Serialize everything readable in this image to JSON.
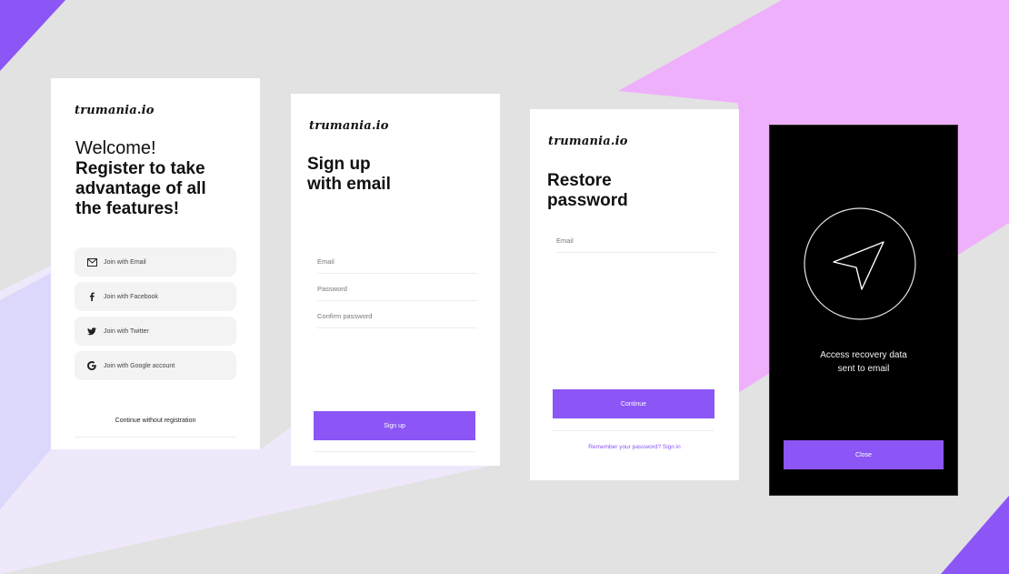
{
  "colors": {
    "background": "#e2e2e2",
    "accent": "#8c55f6",
    "pink": "#efb0fb",
    "lavender": "#dcd8fb",
    "card": "#ffffff",
    "dark_card": "#000000"
  },
  "card1": {
    "logo": "trumania.io",
    "welcome": "Welcome!",
    "headline_lines": [
      "Register to take",
      "advantage of all",
      "the features!"
    ],
    "buttons": [
      {
        "label": "Join with Email",
        "icon": "mail-icon"
      },
      {
        "label": "Join with Facebook",
        "icon": "facebook-icon"
      },
      {
        "label": "Join with Twitter",
        "icon": "twitter-icon"
      },
      {
        "label": "Join with Google account",
        "icon": "google-icon"
      }
    ],
    "continue_link": "Continue without registration"
  },
  "card2": {
    "logo": "trumania.io",
    "title_lines": [
      "Sign up",
      "with email"
    ],
    "fields": [
      {
        "placeholder": "Email"
      },
      {
        "placeholder": "Password"
      },
      {
        "placeholder": "Confirm password"
      }
    ],
    "submit": "Sign up"
  },
  "card3": {
    "logo": "trumania.io",
    "title_lines": [
      "Restore",
      "password"
    ],
    "field": {
      "placeholder": "Email"
    },
    "submit": "Continue",
    "footer_link": "Remember your password? Sign in"
  },
  "card4": {
    "icon": "send-arrow-icon",
    "message_lines": [
      "Access recovery data",
      "sent to email"
    ],
    "close": "Close"
  }
}
